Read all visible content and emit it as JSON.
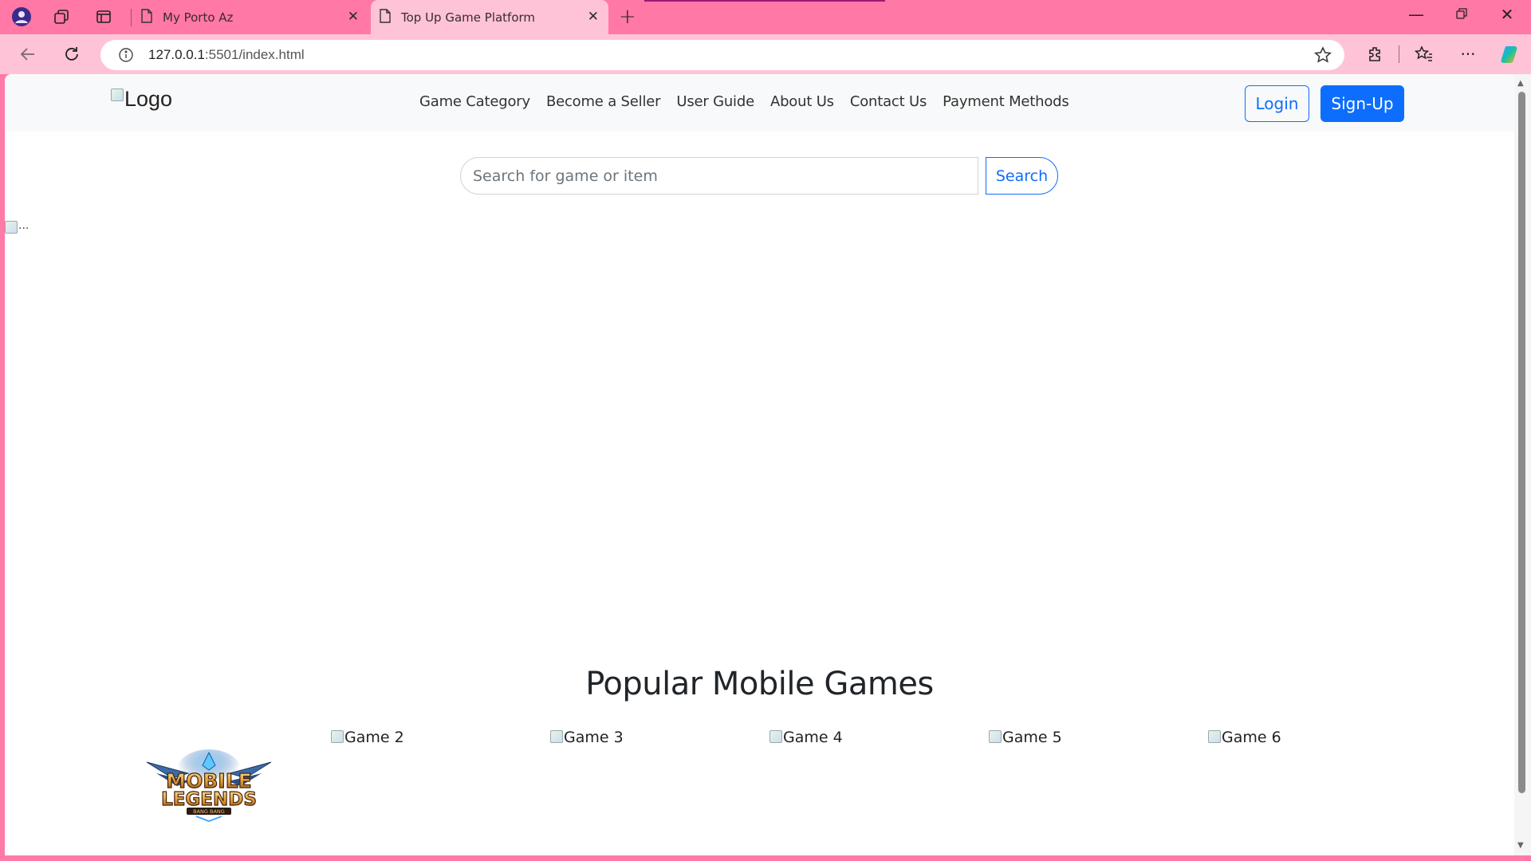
{
  "browser": {
    "tabs": [
      {
        "title": "My Porto Az",
        "active": false
      },
      {
        "title": "Top Up Game Platform",
        "active": true
      }
    ],
    "address": {
      "host": "127.0.0.1",
      "rest": ":5501/index.html"
    },
    "icons": [
      "browser-profile-icon",
      "workspaces-icon",
      "tab-actions-icon",
      "back-icon",
      "refresh-icon",
      "info-icon",
      "favorite-star-icon",
      "extensions-icon",
      "favorites-icon",
      "more-icon",
      "copilot-icon"
    ]
  },
  "page": {
    "logo_alt": "Logo",
    "nav": [
      "Game Category",
      "Become a Seller",
      "User Guide",
      "About Us",
      "Contact Us",
      "Payment Methods"
    ],
    "login_label": "Login",
    "signup_label": "Sign-Up",
    "search": {
      "placeholder": "Search for game or item",
      "button": "Search"
    },
    "hero_alt": "...",
    "section_title": "Popular Mobile Games",
    "games": [
      {
        "alt": "Game 2"
      },
      {
        "alt": "Game 3"
      },
      {
        "alt": "Game 4"
      },
      {
        "alt": "Game 5"
      },
      {
        "alt": "Game 6"
      }
    ],
    "featured_game_logo": {
      "line1": "MOBILE",
      "line2": "LEGENDS",
      "line3": "BANG BANG"
    }
  },
  "colors": {
    "browser_chrome": "#ff78a6",
    "active_tab": "#ffc3d7",
    "primary": "#0d6efd"
  }
}
